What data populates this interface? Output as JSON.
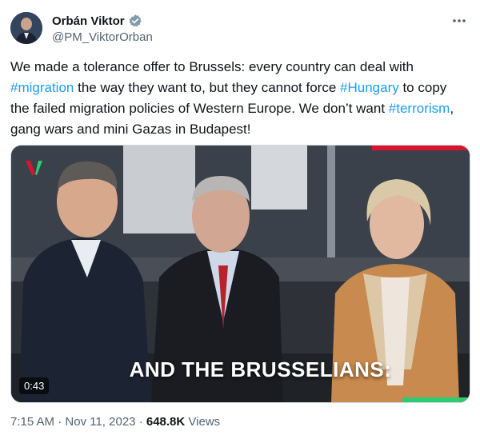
{
  "author": {
    "display_name": "Orbán Viktor",
    "handle": "@PM_ViktorOrban"
  },
  "tweet": {
    "segments": [
      {
        "text": "We made a tolerance offer to Brussels: every country can deal with ",
        "type": "text"
      },
      {
        "text": "#migration",
        "type": "hashtag"
      },
      {
        "text": " the way they want to, but they cannot force ",
        "type": "text"
      },
      {
        "text": "#Hungary",
        "type": "hashtag"
      },
      {
        "text": " to copy the failed migration policies of Western Europe. We don’t want ",
        "type": "text"
      },
      {
        "text": "#terrorism",
        "type": "hashtag"
      },
      {
        "text": ", gang wars and mini Gazas in Budapest!",
        "type": "text"
      }
    ]
  },
  "media": {
    "caption": "AND THE BRUSSELIANS:",
    "duration": "0:43"
  },
  "meta": {
    "time": "7:15 AM",
    "date": "Nov 11, 2023",
    "views_count": "648.8K",
    "views_label": "Views",
    "separator": "·"
  },
  "colors": {
    "accent": "#1d9bf0",
    "text": "#0f1419",
    "secondary": "#536471"
  },
  "icons": {
    "verified": "verified-badge-icon",
    "more": "more-dots-icon"
  }
}
